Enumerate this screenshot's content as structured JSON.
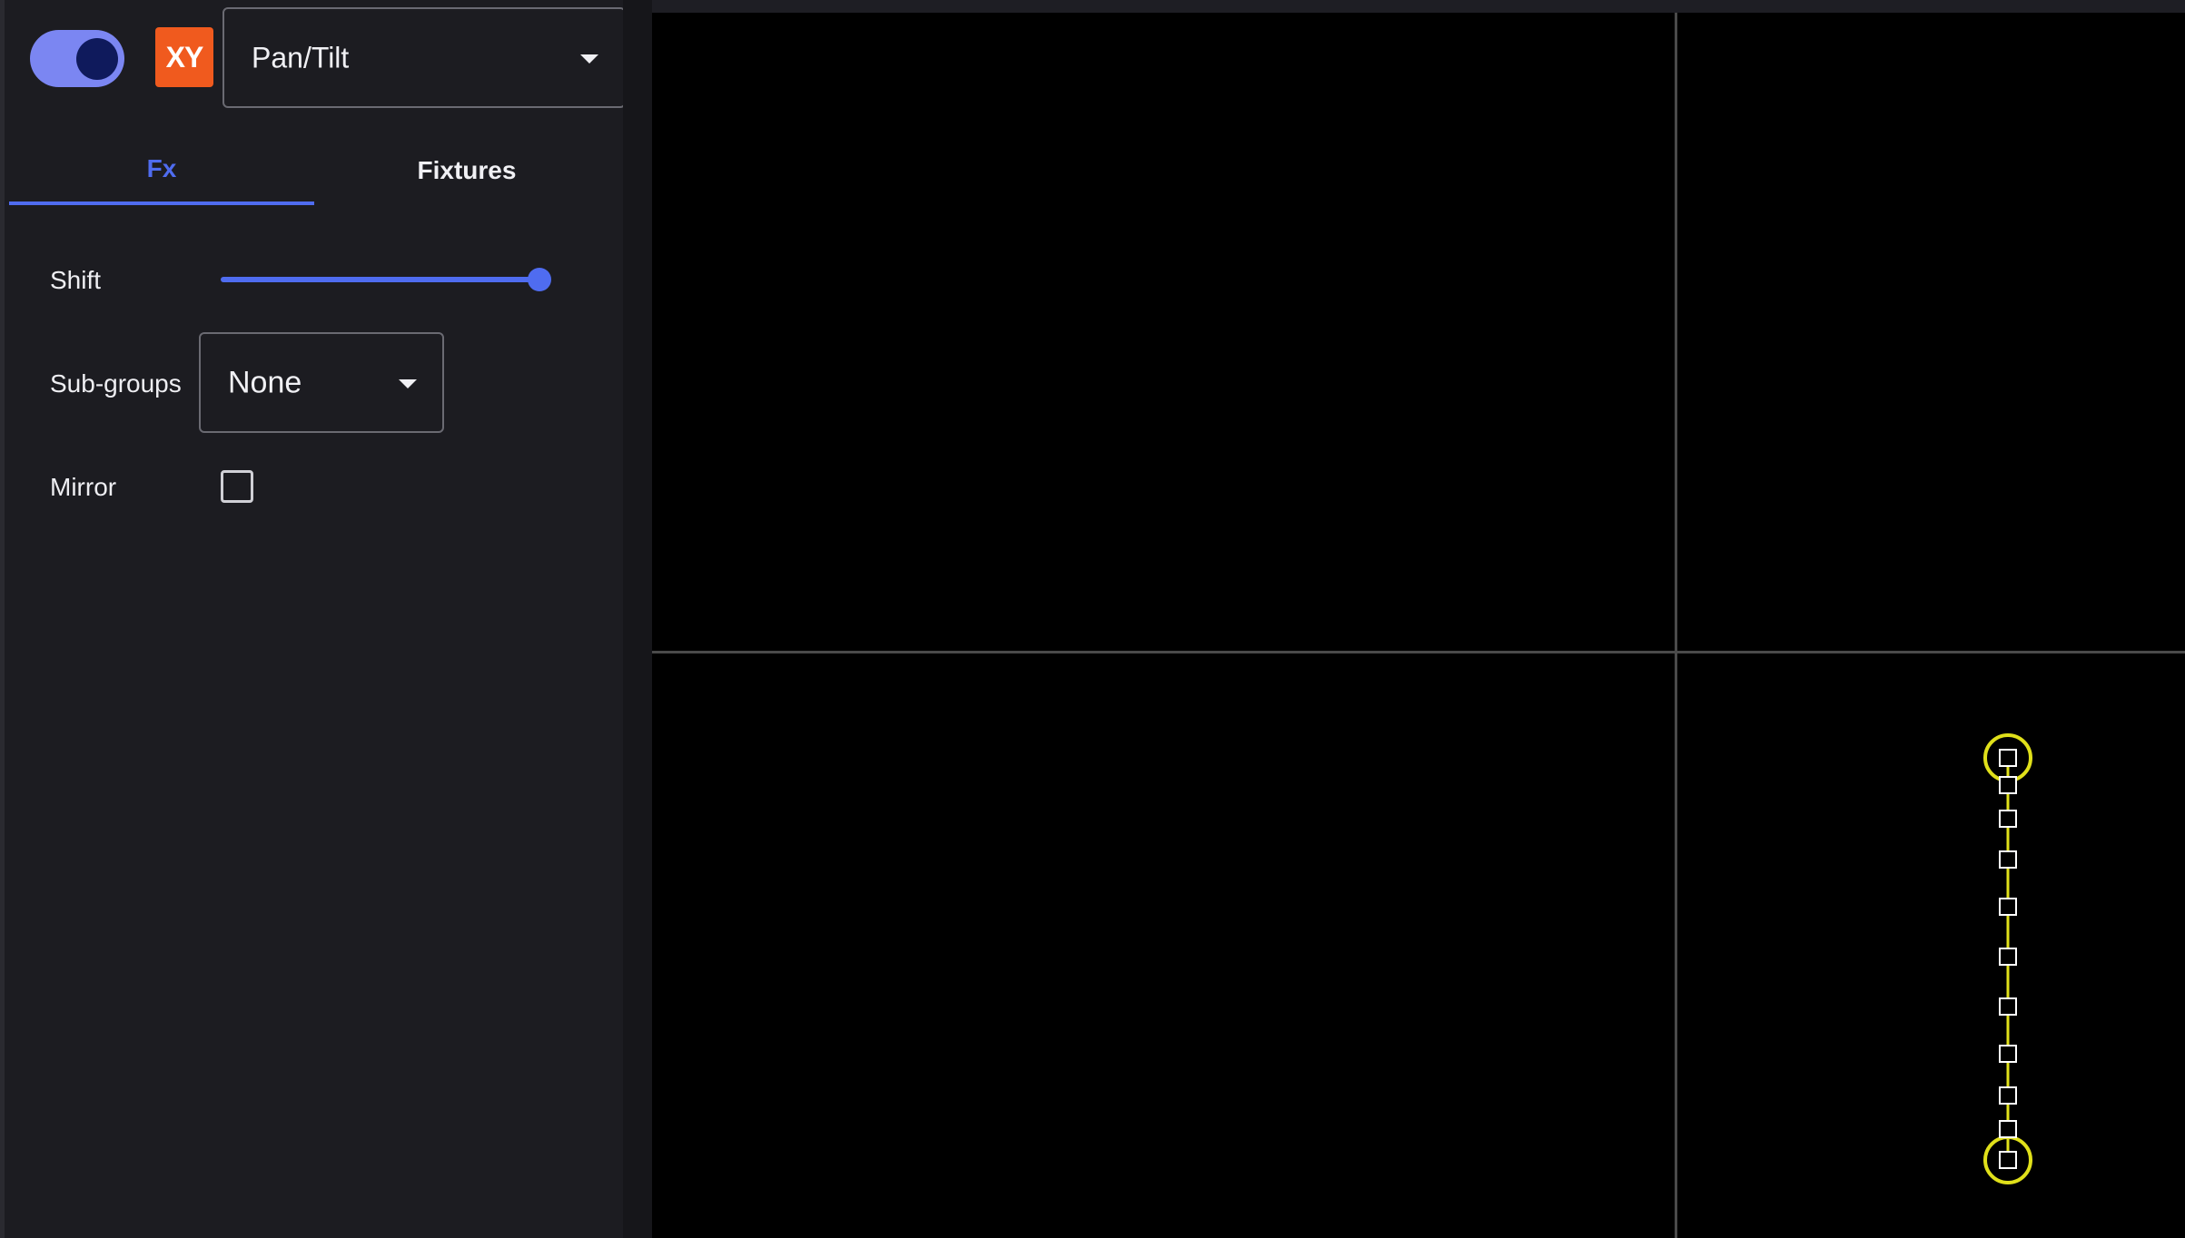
{
  "header": {
    "toggle_state": "on",
    "badge_label": "XY",
    "mode_select": {
      "value": "Pan/Tilt"
    }
  },
  "tabs": [
    {
      "label": "Fx",
      "active": true
    },
    {
      "label": "Fixtures",
      "active": false
    }
  ],
  "fx": {
    "shift_label": "Shift",
    "shift_value": 1.0,
    "subgroups_label": "Sub-groups",
    "subgroups_value": "None",
    "mirror_label": "Mirror",
    "mirror_checked": false
  },
  "preview": {
    "fixture_count": 12,
    "path_color": "#e0e01a",
    "axis_color": "#4a4a4a"
  },
  "colors": {
    "accent": "#4f6cf0",
    "badge": "#f05a1e",
    "panel": "#1c1c21"
  }
}
